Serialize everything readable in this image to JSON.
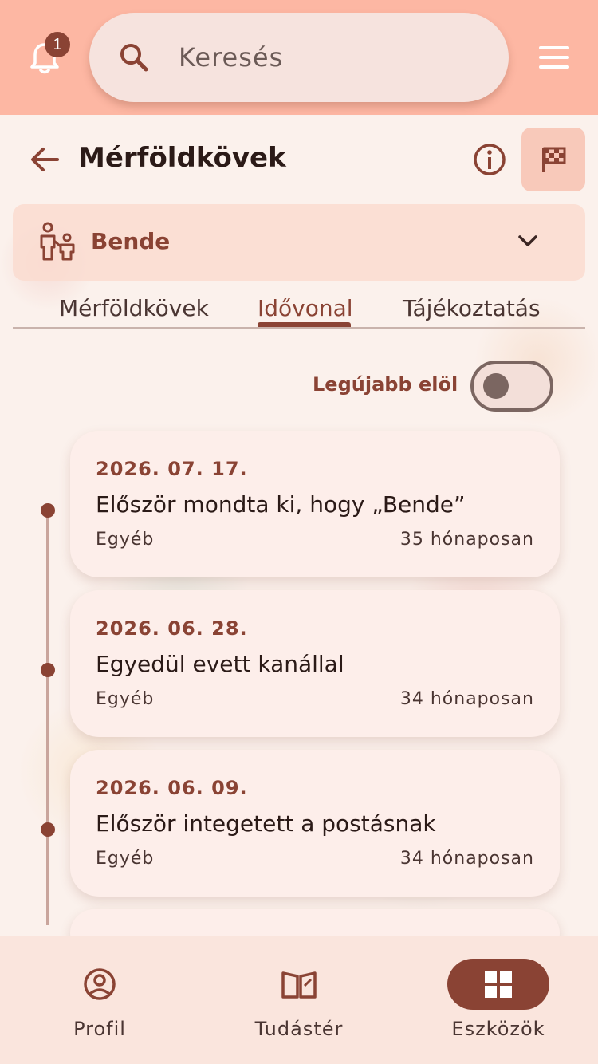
{
  "topbar": {
    "notification_count": "1",
    "search_placeholder": "Keresés"
  },
  "header": {
    "title": "Mérföldkövek"
  },
  "child_selector": {
    "name": "Bende"
  },
  "tabs": [
    {
      "label": "Mérföldkövek",
      "active": false
    },
    {
      "label": "Idővonal",
      "active": true
    },
    {
      "label": "Tájékoztatás",
      "active": false
    }
  ],
  "sort": {
    "label": "Legújabb elöl",
    "enabled": false
  },
  "milestones": [
    {
      "date": "2026. 07. 17.",
      "title": "Először mondta ki, hogy „Bende”",
      "category": "Egyéb",
      "age": "35 hónaposan"
    },
    {
      "date": "2026. 06. 28.",
      "title": "Egyedül evett kanállal",
      "category": "Egyéb",
      "age": "34 hónaposan"
    },
    {
      "date": "2026. 06. 09.",
      "title": "Először integetett a postásnak",
      "category": "Egyéb",
      "age": "34 hónaposan"
    }
  ],
  "bottom_nav": [
    {
      "label": "Profil",
      "icon": "profile-icon",
      "active": false
    },
    {
      "label": "Tudástér",
      "icon": "book-icon",
      "active": false
    },
    {
      "label": "Eszközök",
      "icon": "grid-icon",
      "active": true
    }
  ],
  "colors": {
    "accent": "#8a4334",
    "topbar": "#fdb7a3"
  }
}
